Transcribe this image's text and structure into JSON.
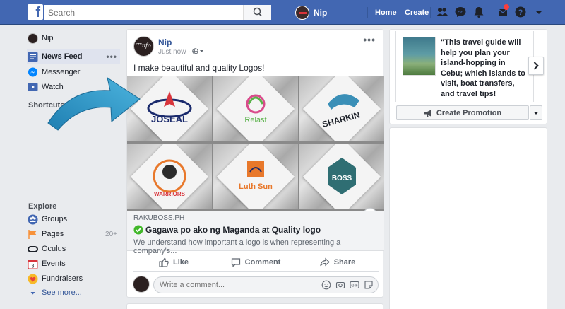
{
  "topbar": {
    "logo": "f",
    "search_placeholder": "Search",
    "profile_name": "Nip",
    "home_label": "Home",
    "create_label": "Create",
    "icons": [
      "friends-icon",
      "messenger-icon",
      "bell-icon",
      "notifications-icon",
      "help-icon",
      "chevron-down-icon"
    ],
    "brand_color": "#4267b2"
  },
  "sidebar": {
    "profile_name": "Nip",
    "items": [
      {
        "label": "News Feed",
        "icon": "news-feed-icon",
        "more": "•••"
      },
      {
        "label": "Messenger",
        "icon": "messenger-icon"
      },
      {
        "label": "Watch",
        "icon": "watch-icon"
      }
    ],
    "shortcuts_title": "Shortcuts",
    "explore_title": "Explore",
    "explore_items": [
      {
        "label": "Groups",
        "icon": "groups-icon"
      },
      {
        "label": "Pages",
        "icon": "pages-icon",
        "count": "20+"
      },
      {
        "label": "Oculus",
        "icon": "oculus-icon"
      },
      {
        "label": "Events",
        "icon": "events-icon",
        "badge": "3"
      },
      {
        "label": "Fundraisers",
        "icon": "fundraisers-icon"
      }
    ],
    "see_more": "See more..."
  },
  "post": {
    "author": "Nip",
    "time": "Just now ·",
    "text": "I make beautiful and quality Logos!",
    "images": [
      "JOSEAL",
      "Relast",
      "SHARKIN",
      "WARRIORS",
      "Luth Sun",
      "BOSS"
    ],
    "link": {
      "domain": "RAKUBOSS.PH",
      "title": "Gagawa po ako ng Maganda at Quality logo",
      "description": "We understand how important a logo is when representing a company's..."
    },
    "info_badge": "i",
    "actions": {
      "like": "Like",
      "comment": "Comment",
      "share": "Share"
    },
    "comment_placeholder": "Write a comment..."
  },
  "promotion": {
    "text": "\"This travel guide will help you plan your island-hopping in Cebu; which islands to visit, boat transfers, and travel tips!",
    "button": "Create Promotion"
  }
}
